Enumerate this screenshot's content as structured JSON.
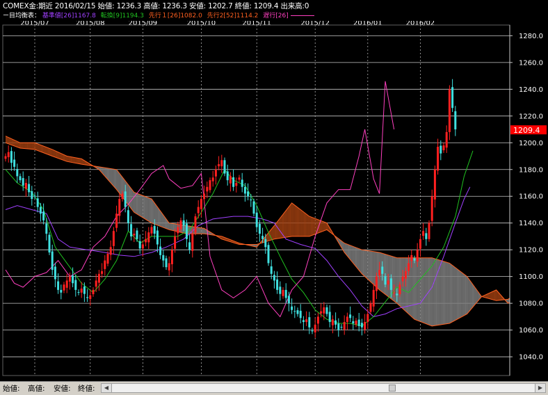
{
  "header": {
    "line1": "COMEX金:期近  2016/02/15  始値: 1236.3  高値: 1236.3  安値: 1202.7  終値: 1209.4  出来高:0",
    "line2_prefix": "ー目均衡表：",
    "kijun": "基準値[26]1167.8",
    "tenkan": "転換[9]1194.3",
    "senko1": "先行１[26]1082.0",
    "senko2": "先行2[52]1114.2",
    "chikou": "遅行[26]"
  },
  "colors": {
    "kijun": "#a040ff",
    "tenkan": "#20c020",
    "senko1": "#ff6020",
    "senko2": "#ff6020",
    "chikou": "#ff40c0",
    "candle_up": "#ff2020",
    "candle_down": "#40e0e0",
    "cloud_bear": "#808080",
    "cloud_bull": "#a04010",
    "last_price_bg": "#ff0000"
  },
  "footer": {
    "open_label": "始値:",
    "high_label": "高値:",
    "low_label": "安値:",
    "close_label": "終値:"
  },
  "chart_data": {
    "type": "line",
    "title": "COMEX金:期近",
    "x_ticks": [
      "2015/07",
      "2015/08",
      "2015/09",
      "2015/10",
      "2015/11",
      "2015/12",
      "2016/01",
      "2016/02"
    ],
    "y_ticks": [
      "1280.0",
      "1260.0",
      "1240.0",
      "1220.0",
      "1200.0",
      "1180.0",
      "1160.0",
      "1140.0",
      "1120.0",
      "1100.0",
      "1080.0",
      "1060.0",
      "1040.0"
    ],
    "ylim": [
      1026,
      1288
    ],
    "last_price": "1209.4",
    "close": [
      1190,
      1193,
      1185,
      1182,
      1175,
      1172,
      1168,
      1170,
      1163,
      1158,
      1160,
      1152,
      1147,
      1142,
      1132,
      1118,
      1105,
      1098,
      1090,
      1088,
      1094,
      1097,
      1100,
      1095,
      1090,
      1088,
      1091,
      1087,
      1084,
      1086,
      1090,
      1097,
      1102,
      1104,
      1112,
      1117,
      1122,
      1134,
      1147,
      1158,
      1162,
      1152,
      1140,
      1130,
      1132,
      1128,
      1121,
      1124,
      1128,
      1133,
      1137,
      1132,
      1124,
      1116,
      1112,
      1107,
      1110,
      1120,
      1130,
      1137,
      1142,
      1138,
      1128,
      1120,
      1132,
      1145,
      1152,
      1158,
      1162,
      1167,
      1172,
      1174,
      1180,
      1184,
      1187,
      1177,
      1172,
      1175,
      1167,
      1170,
      1174,
      1167,
      1162,
      1160,
      1157,
      1147,
      1137,
      1132,
      1128,
      1122,
      1110,
      1102,
      1097,
      1090,
      1087,
      1090,
      1084,
      1080,
      1075,
      1074,
      1072,
      1069,
      1066,
      1068,
      1062,
      1059,
      1064,
      1070,
      1074,
      1077,
      1072,
      1066,
      1068,
      1064,
      1060,
      1062,
      1066,
      1070,
      1069,
      1065,
      1067,
      1063,
      1062,
      1066,
      1072,
      1080,
      1090,
      1100,
      1105,
      1102,
      1094,
      1097,
      1090,
      1088,
      1086,
      1094,
      1100,
      1104,
      1110,
      1116,
      1112,
      1120,
      1128,
      1134,
      1128,
      1140,
      1160,
      1180,
      1197,
      1192,
      1198,
      1208,
      1240,
      1226,
      1210
    ],
    "series": [
      {
        "name": "基準値[26]",
        "color": "#a040ff",
        "points": [
          [
            0,
            1150
          ],
          [
            4,
            1153
          ],
          [
            9,
            1150
          ],
          [
            14,
            1147
          ],
          [
            18,
            1128
          ],
          [
            22,
            1122
          ],
          [
            28,
            1120
          ],
          [
            34,
            1118
          ],
          [
            39,
            1116
          ],
          [
            44,
            1115
          ],
          [
            50,
            1118
          ],
          [
            55,
            1122
          ],
          [
            61,
            1128
          ],
          [
            66,
            1138
          ],
          [
            71,
            1143
          ],
          [
            78,
            1145
          ],
          [
            83,
            1145
          ],
          [
            88,
            1143
          ],
          [
            92,
            1140
          ],
          [
            96,
            1128
          ],
          [
            101,
            1124
          ],
          [
            106,
            1121
          ],
          [
            110,
            1112
          ],
          [
            114,
            1100
          ],
          [
            118,
            1090
          ],
          [
            122,
            1078
          ],
          [
            126,
            1070
          ],
          [
            130,
            1072
          ],
          [
            134,
            1076
          ],
          [
            138,
            1078
          ],
          [
            142,
            1080
          ],
          [
            146,
            1092
          ],
          [
            150,
            1115
          ],
          [
            154,
            1140
          ],
          [
            157,
            1158
          ],
          [
            159,
            1167
          ]
        ]
      },
      {
        "name": "転換[9]",
        "color": "#20c020",
        "points": [
          [
            0,
            1180
          ],
          [
            4,
            1170
          ],
          [
            9,
            1163
          ],
          [
            13,
            1150
          ],
          [
            17,
            1122
          ],
          [
            21,
            1110
          ],
          [
            26,
            1095
          ],
          [
            30,
            1088
          ],
          [
            34,
            1098
          ],
          [
            38,
            1112
          ],
          [
            42,
            1134
          ],
          [
            46,
            1125
          ],
          [
            50,
            1130
          ],
          [
            55,
            1130
          ],
          [
            59,
            1130
          ],
          [
            63,
            1135
          ],
          [
            67,
            1148
          ],
          [
            71,
            1162
          ],
          [
            75,
            1180
          ],
          [
            78,
            1172
          ],
          [
            82,
            1168
          ],
          [
            86,
            1153
          ],
          [
            90,
            1133
          ],
          [
            94,
            1115
          ],
          [
            98,
            1098
          ],
          [
            102,
            1088
          ],
          [
            106,
            1075
          ],
          [
            110,
            1068
          ],
          [
            114,
            1065
          ],
          [
            118,
            1065
          ],
          [
            122,
            1063
          ],
          [
            126,
            1070
          ],
          [
            130,
            1081
          ],
          [
            134,
            1092
          ],
          [
            138,
            1088
          ],
          [
            142,
            1098
          ],
          [
            146,
            1108
          ],
          [
            150,
            1122
          ],
          [
            154,
            1145
          ],
          [
            157,
            1175
          ],
          [
            160,
            1194
          ]
        ]
      },
      {
        "name": "遅行[26]",
        "color": "#ff40c0",
        "points": [
          [
            0,
            1105
          ],
          [
            3,
            1095
          ],
          [
            6,
            1092
          ],
          [
            10,
            1100
          ],
          [
            14,
            1103
          ],
          [
            18,
            1112
          ],
          [
            22,
            1100
          ],
          [
            26,
            1105
          ],
          [
            30,
            1122
          ],
          [
            34,
            1130
          ],
          [
            38,
            1145
          ],
          [
            42,
            1154
          ],
          [
            46,
            1165
          ],
          [
            50,
            1177
          ],
          [
            54,
            1183
          ],
          [
            56,
            1173
          ],
          [
            60,
            1166
          ],
          [
            64,
            1168
          ],
          [
            67,
            1177
          ],
          [
            70,
            1115
          ],
          [
            74,
            1090
          ],
          [
            78,
            1084
          ],
          [
            82,
            1090
          ],
          [
            86,
            1100
          ],
          [
            90,
            1080
          ],
          [
            94,
            1070
          ],
          [
            98,
            1090
          ],
          [
            102,
            1100
          ],
          [
            106,
            1130
          ],
          [
            110,
            1155
          ],
          [
            114,
            1165
          ],
          [
            118,
            1165
          ],
          [
            121,
            1190
          ],
          [
            123,
            1210
          ],
          [
            126,
            1173
          ],
          [
            128,
            1162
          ],
          [
            130,
            1246
          ],
          [
            133,
            1210
          ]
        ]
      }
    ],
    "cloud_senko1": [
      [
        0,
        1205
      ],
      [
        5,
        1200
      ],
      [
        10,
        1200
      ],
      [
        16,
        1195
      ],
      [
        21,
        1190
      ],
      [
        26,
        1188
      ],
      [
        32,
        1180
      ],
      [
        38,
        1165
      ],
      [
        44,
        1148
      ],
      [
        50,
        1140
      ],
      [
        56,
        1135
      ],
      [
        62,
        1132
      ],
      [
        68,
        1132
      ],
      [
        74,
        1130
      ],
      [
        80,
        1125
      ],
      [
        86,
        1122
      ],
      [
        92,
        1138
      ],
      [
        98,
        1155
      ],
      [
        104,
        1145
      ],
      [
        110,
        1140
      ],
      [
        116,
        1118
      ],
      [
        122,
        1102
      ],
      [
        128,
        1090
      ],
      [
        134,
        1080
      ],
      [
        140,
        1068
      ],
      [
        146,
        1063
      ],
      [
        152,
        1065
      ],
      [
        158,
        1072
      ],
      [
        163,
        1085
      ],
      [
        168,
        1090
      ],
      [
        172,
        1080
      ],
      [
        177,
        1085
      ],
      [
        181,
        1100
      ],
      [
        185,
        1140
      ],
      [
        188,
        1180
      ]
    ],
    "cloud_senko2": [
      [
        0,
        1200
      ],
      [
        5,
        1196
      ],
      [
        10,
        1195
      ],
      [
        16,
        1190
      ],
      [
        21,
        1186
      ],
      [
        26,
        1184
      ],
      [
        32,
        1182
      ],
      [
        38,
        1180
      ],
      [
        44,
        1163
      ],
      [
        50,
        1158
      ],
      [
        56,
        1140
      ],
      [
        62,
        1138
      ],
      [
        68,
        1136
      ],
      [
        74,
        1128
      ],
      [
        80,
        1124
      ],
      [
        86,
        1124
      ],
      [
        92,
        1128
      ],
      [
        98,
        1130
      ],
      [
        104,
        1130
      ],
      [
        110,
        1135
      ],
      [
        116,
        1125
      ],
      [
        122,
        1120
      ],
      [
        128,
        1118
      ],
      [
        134,
        1114
      ],
      [
        140,
        1114
      ],
      [
        146,
        1114
      ],
      [
        152,
        1110
      ],
      [
        158,
        1100
      ],
      [
        163,
        1085
      ],
      [
        168,
        1082
      ],
      [
        172,
        1083
      ],
      [
        177,
        1090
      ],
      [
        181,
        1100
      ],
      [
        185,
        1110
      ],
      [
        188,
        1178
      ]
    ]
  }
}
